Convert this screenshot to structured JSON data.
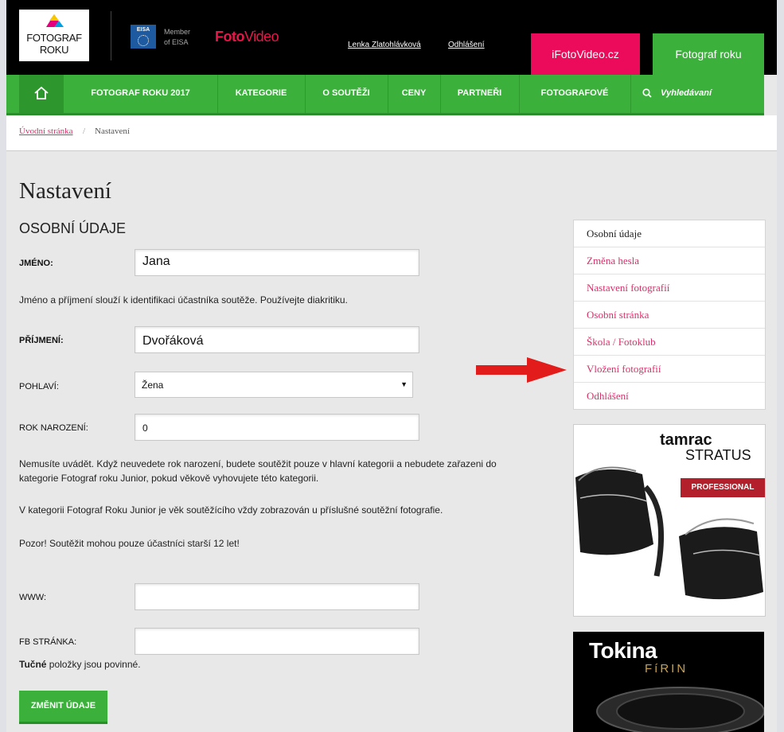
{
  "header": {
    "logo_line1": "FOTOGRAF",
    "logo_line2": "ROKU",
    "eisa_badge": "EISA",
    "member_line1": "Member",
    "member_line2": "of EISA",
    "fotovideo_part1": "Foto",
    "fotovideo_part2": "Video",
    "user_name": "Lenka Zlatohlávková",
    "logout": "Odhlášení",
    "btn_ifotovideo": "iFotoVideo.cz",
    "btn_fotograf_roku": "Fotograf roku"
  },
  "nav": {
    "home_icon": "home-icon",
    "items": [
      "FOTOGRAF ROKU 2017",
      "KATEGORIE",
      "O SOUTĚŽI",
      "CENY",
      "PARTNEŘI",
      "FOTOGRAFOVÉ"
    ],
    "search_placeholder": "Vyhledávaní"
  },
  "breadcrumb": {
    "home": "Úvodní stránka",
    "separator": "/",
    "current": "Nastavení"
  },
  "main": {
    "title": "Nastavení",
    "section": "OSOBNÍ ÚDAJE",
    "first_name_label": "JMÉNO:",
    "first_name_value": "Jana",
    "first_name_help": "Jméno a příjmení slouží k identifikaci účastníka soutěže. Používejte diakritiku.",
    "last_name_label": "PŘÍJMENÍ:",
    "last_name_value": "Dvořáková",
    "gender_label": "POHLAVÍ:",
    "gender_value": "Žena",
    "birth_year_label": "ROK NAROZENÍ:",
    "birth_year_value": "0",
    "help_birth_line1": "Nemusíte uvádět. Když neuvedete rok narození, budete soutěžit pouze v hlavní kategorii a nebudete zařazeni do",
    "help_birth_line2": "kategorie Fotograf roku Junior, pokud věkově vyhovujete této kategorii.",
    "help_junior": "V kategorii Fotograf Roku Junior je věk soutěžícího vždy zobrazován u příslušné soutěžní fotografie.",
    "help_age": "Pozor! Soutěžit mohou pouze účastníci starší 12 let!",
    "www_label": "WWW:",
    "www_value": "",
    "fb_label": "FB STRÁNKA:",
    "fb_value": "",
    "required_bold": "Tučné",
    "required_rest": " položky jsou povinné.",
    "save_button": "ZMĚNIT ÚDAJE"
  },
  "sidebar": {
    "items": [
      {
        "label": "Osobní údaje",
        "active": true
      },
      {
        "label": "Změna hesla",
        "active": false
      },
      {
        "label": "Nastavení fotografií",
        "active": false
      },
      {
        "label": "Osobní stránka",
        "active": false
      },
      {
        "label": "Škola / Fotoklub",
        "active": false
      },
      {
        "label": "Vložení fotografií",
        "active": false
      },
      {
        "label": "Odhlášení",
        "active": false
      }
    ]
  },
  "ads": {
    "tamrac_brand": "tamrac",
    "tamrac_model": "STRATUS",
    "tamrac_badge": "PROFESSIONAL",
    "tokina_brand": "Tokina",
    "tokina_sub": "FíRIN"
  },
  "colors": {
    "accent_green": "#3bb13b",
    "link_pink": "#d5326b",
    "ifoto_pink": "#ec0a5b",
    "annotation_arrow": "#e21b1b"
  }
}
